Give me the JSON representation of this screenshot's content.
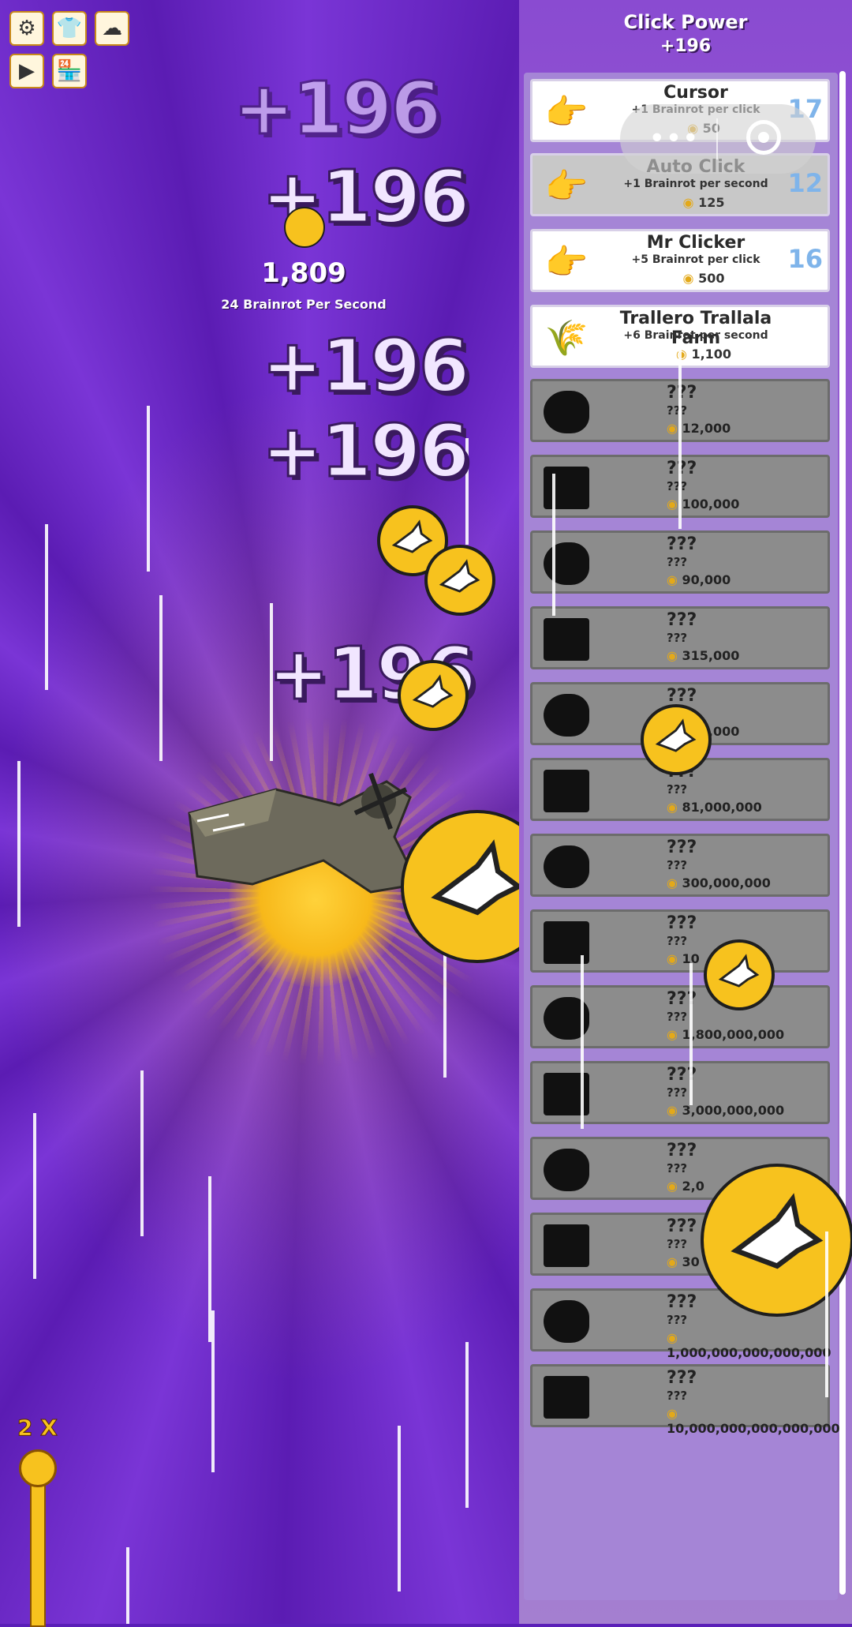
{
  "top_buttons": [
    {
      "icon": "gear-icon"
    },
    {
      "icon": "shirt-icon"
    },
    {
      "icon": "cloud-icon"
    },
    {
      "icon": "play-icon"
    },
    {
      "icon": "shop-icon"
    }
  ],
  "stats": {
    "total": "1,809",
    "per_second": "24 Brainrot Per Second"
  },
  "floating_texts": [
    "+196",
    "+196",
    "+196",
    "+196",
    "+196",
    "+196"
  ],
  "click_power": {
    "title": "Click Power",
    "value": "+196"
  },
  "shop": {
    "items": [
      {
        "name": "Cursor",
        "desc": "+1 Brainrot per click",
        "cost": "50",
        "count": "17",
        "state": "owned",
        "icon": "pointing-hand-icon"
      },
      {
        "name": "Auto Click",
        "desc": "+1 Brainrot per second",
        "cost": "125",
        "count": "12",
        "state": "dim",
        "icon": "clicking-hand-icon"
      },
      {
        "name": "Mr Clicker",
        "desc": "+5 Brainrot per click",
        "cost": "500",
        "count": "16",
        "state": "owned",
        "icon": "hand-icon"
      },
      {
        "name": "Trallero Trallala Farm",
        "desc": "+6 Brainrot per second",
        "cost": "1,100",
        "count": "",
        "state": "owned",
        "icon": "farm-icon"
      },
      {
        "name": "???",
        "desc": "???",
        "cost": "12,000",
        "state": "locked",
        "icon": "silhouette-icon"
      },
      {
        "name": "???",
        "desc": "???",
        "cost": "100,000",
        "state": "locked",
        "icon": "silhouette-factory-icon"
      },
      {
        "name": "???",
        "desc": "???",
        "cost": "90,000",
        "state": "locked",
        "icon": "silhouette-icon"
      },
      {
        "name": "???",
        "desc": "???",
        "cost": "315,000",
        "state": "locked",
        "icon": "silhouette-factory-icon"
      },
      {
        "name": "???",
        "desc": "???",
        "cost": "000,000",
        "state": "locked",
        "icon": "silhouette-icon"
      },
      {
        "name": "???",
        "desc": "???",
        "cost": "81,000,000",
        "state": "locked",
        "icon": "silhouette-icon"
      },
      {
        "name": "???",
        "desc": "???",
        "cost": "300,000,000",
        "state": "locked",
        "icon": "silhouette-icon"
      },
      {
        "name": "???",
        "desc": "???",
        "cost": "10",
        "state": "locked",
        "icon": "silhouette-temple-icon"
      },
      {
        "name": "???",
        "desc": "???",
        "cost": "1,800,000,000",
        "state": "locked",
        "icon": "silhouette-angel-icon"
      },
      {
        "name": "???",
        "desc": "???",
        "cost": "3,000,000,000",
        "state": "locked",
        "icon": "silhouette-icon"
      },
      {
        "name": "???",
        "desc": "???",
        "cost": "2,0",
        "state": "locked",
        "icon": "silhouette-angel-icon"
      },
      {
        "name": "???",
        "desc": "???",
        "cost": "30",
        "state": "locked",
        "icon": "silhouette-icon"
      },
      {
        "name": "???",
        "desc": "???",
        "cost": "1,000,000,000,000,000",
        "state": "locked",
        "icon": "silhouette-splash-icon"
      },
      {
        "name": "???",
        "desc": "???",
        "cost": "10,000,000,000,000,000",
        "state": "locked",
        "icon": "silhouette-galaxy-icon"
      }
    ]
  },
  "multiplier": {
    "label": "2 X"
  },
  "overlay": {
    "icons": [
      "more-dots-icon",
      "target-icon"
    ]
  },
  "colors": {
    "coin": "#f7c21e",
    "background": "#5a1fb8",
    "panel": "#9b63d3",
    "count": "#7fb4ea"
  }
}
